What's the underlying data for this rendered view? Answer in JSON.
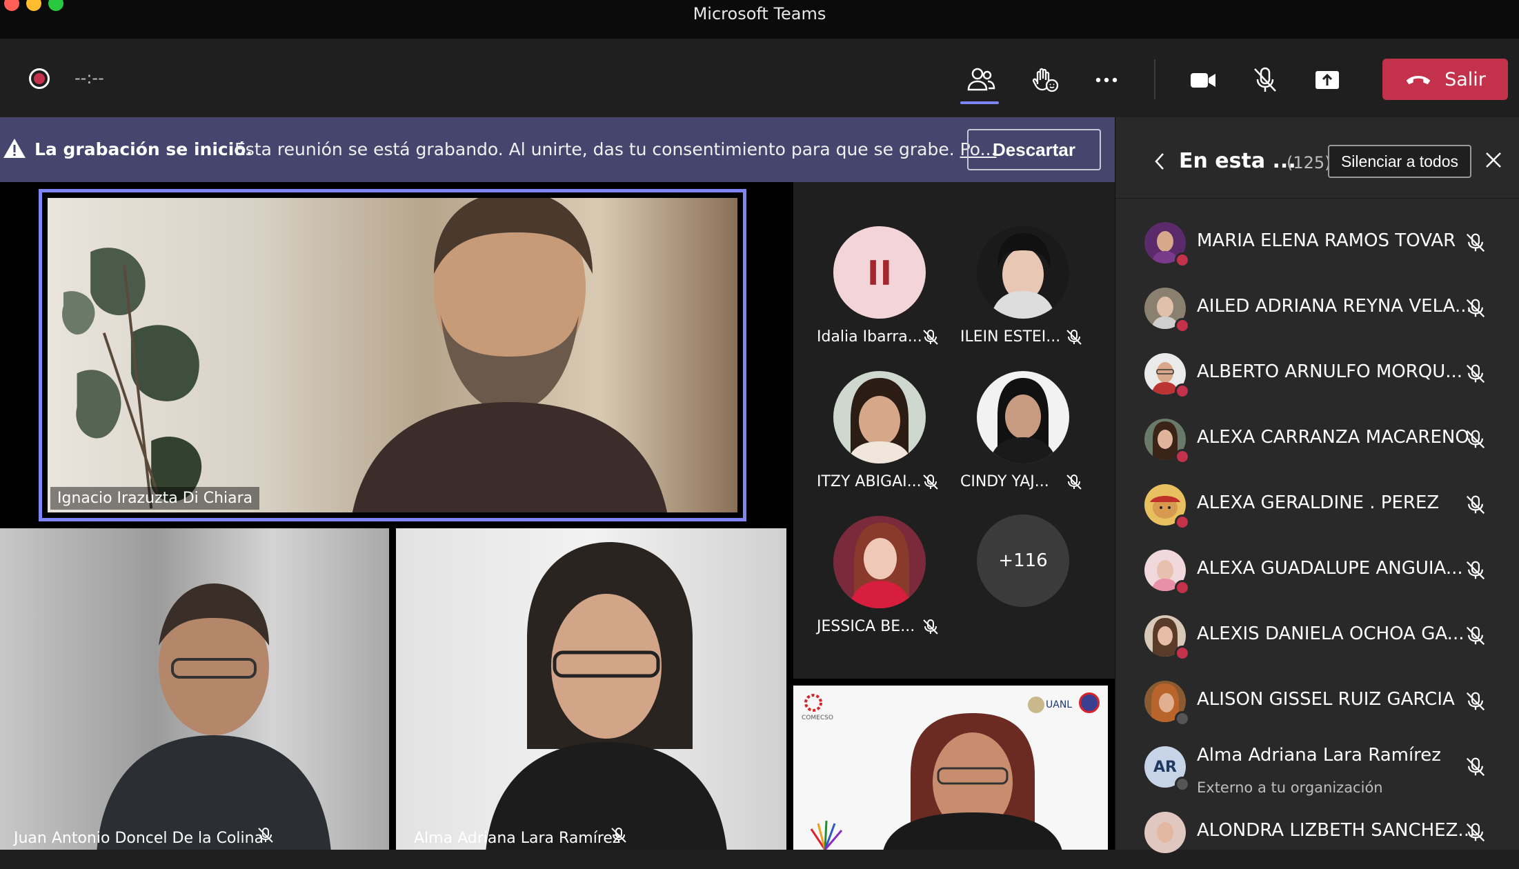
{
  "window": {
    "title": "Microsoft Teams"
  },
  "toolbar": {
    "timer": "--:--",
    "leave_label": "Salir"
  },
  "banner": {
    "title": "La grabación se inició.",
    "message": "Esta reunión se está grabando. Al unirte, das tu consentimiento para que se grabe. ",
    "link": "Po...",
    "dismiss": "Descartar"
  },
  "stage": {
    "main": {
      "name": "Ignacio Irazuzta Di Chiara"
    },
    "bottom_left": {
      "name": "Juan Antonio Doncel De la Colina"
    },
    "bottom_mid": {
      "name": "Alma Adriana Lara Ramírez"
    },
    "grid": [
      {
        "label": "Idalia Ibarra...",
        "type": "paused"
      },
      {
        "label": "ILEIN ESTEI...",
        "type": "photo"
      },
      {
        "label": "ITZY ABIGAI...",
        "type": "photo"
      },
      {
        "label": "CINDY YAJ...",
        "type": "photo"
      },
      {
        "label": "JESSICA BE...",
        "type": "photo"
      },
      {
        "label": "+116",
        "type": "overflow"
      }
    ],
    "shared": {
      "logo_left": "COMECSO",
      "logo_right": "UANL"
    }
  },
  "panel": {
    "title": "En esta ...",
    "count": "(125)",
    "mute_all": "Silenciar a todos",
    "participants": [
      {
        "name": "MARIA ELENA RAMOS TOVAR",
        "status": "busy"
      },
      {
        "name": "AILED ADRIANA REYNA VELA...",
        "status": "busy"
      },
      {
        "name": "ALBERTO ARNULFO MORQU...",
        "status": "busy"
      },
      {
        "name": "ALEXA CARRANZA MACARENO",
        "status": "busy"
      },
      {
        "name": "ALEXA GERALDINE . PEREZ",
        "status": "busy"
      },
      {
        "name": "ALEXA GUADALUPE ANGUIA...",
        "status": "busy"
      },
      {
        "name": "ALEXIS DANIELA OCHOA GA...",
        "status": "busy"
      },
      {
        "name": "ALISON GISSEL RUIZ GARCIA",
        "status": "offline"
      },
      {
        "name": "Alma Adriana Lara Ramírez",
        "subtitle": "Externo a tu organización",
        "initials": "AR",
        "status": "offline"
      },
      {
        "name": "ALONDRA LIZBETH SANCHEZ...",
        "status": "busy"
      }
    ]
  },
  "colors": {
    "accent": "#7f85f5",
    "leave": "#c4314b",
    "banner": "#45456e",
    "busy": "#c4314b"
  }
}
